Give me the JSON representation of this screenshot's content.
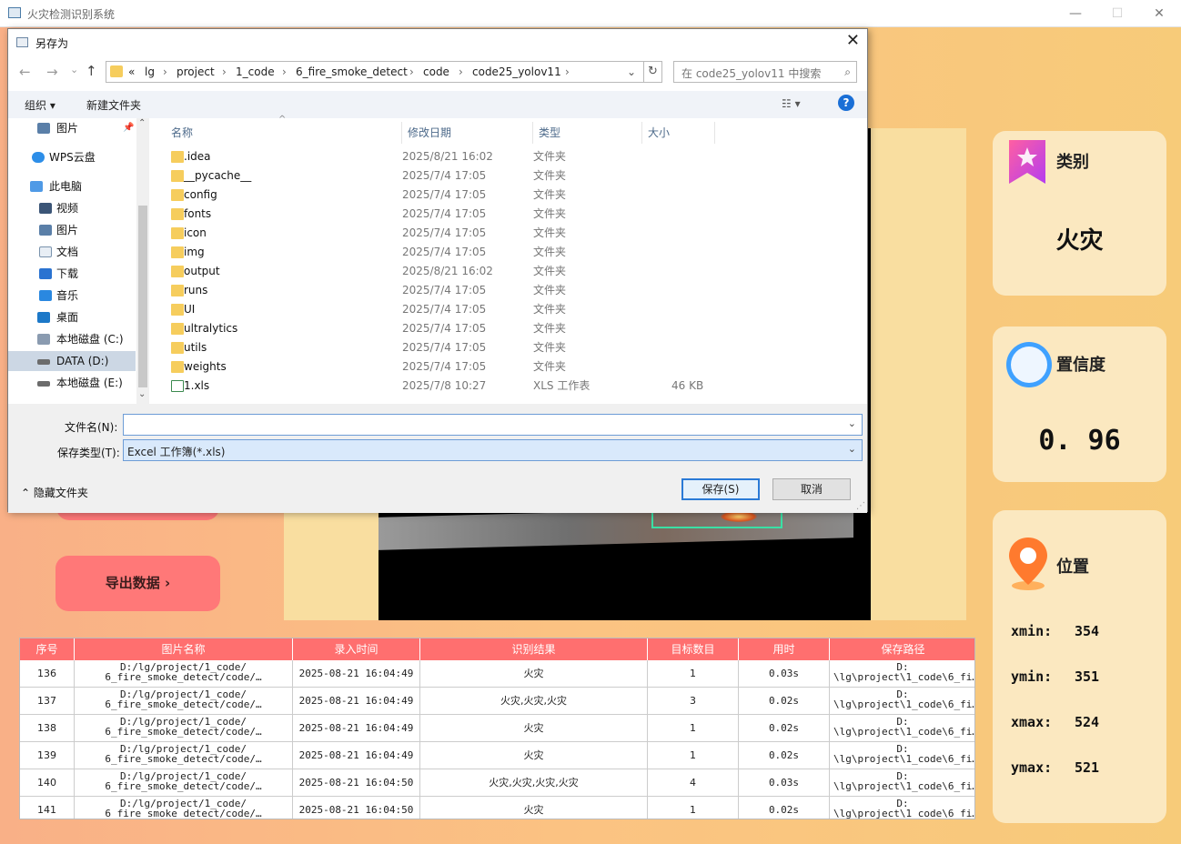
{
  "app": {
    "title": "火灾检测识别系统",
    "minimize": "—",
    "maximize": "☐",
    "close": "✕"
  },
  "buttons": {
    "export_label": "导出数据  ›"
  },
  "cards": {
    "category": {
      "title": "类别",
      "value": "火灾"
    },
    "confidence": {
      "title": "置信度",
      "value": "0. 96"
    },
    "location": {
      "title": "位置",
      "xmin_label": "xmin:",
      "xmin": "354",
      "ymin_label": "ymin:",
      "ymin": "351",
      "xmax_label": "xmax:",
      "xmax": "524",
      "ymax_label": "ymax:",
      "ymax": "521"
    }
  },
  "table": {
    "headers": [
      "序号",
      "图片名称",
      "录入时间",
      "识别结果",
      "目标数目",
      "用时",
      "保存路径"
    ],
    "rows": [
      {
        "id": "136",
        "name1": "D:/lg/project/1_code/",
        "name2": "6_fire_smoke_detect/code/…",
        "time": "2025-08-21 16:04:49",
        "result": "火灾",
        "count": "1",
        "used": "0.03s",
        "path1": "D:",
        "path2": "\\lg\\project\\1_code\\6_fi…"
      },
      {
        "id": "137",
        "name1": "D:/lg/project/1_code/",
        "name2": "6_fire_smoke_detect/code/…",
        "time": "2025-08-21 16:04:49",
        "result": "火灾,火灾,火灾",
        "count": "3",
        "used": "0.02s",
        "path1": "D:",
        "path2": "\\lg\\project\\1_code\\6_fi…"
      },
      {
        "id": "138",
        "name1": "D:/lg/project/1_code/",
        "name2": "6_fire_smoke_detect/code/…",
        "time": "2025-08-21 16:04:49",
        "result": "火灾",
        "count": "1",
        "used": "0.02s",
        "path1": "D:",
        "path2": "\\lg\\project\\1_code\\6_fi…"
      },
      {
        "id": "139",
        "name1": "D:/lg/project/1_code/",
        "name2": "6_fire_smoke_detect/code/…",
        "time": "2025-08-21 16:04:49",
        "result": "火灾",
        "count": "1",
        "used": "0.02s",
        "path1": "D:",
        "path2": "\\lg\\project\\1_code\\6_fi…"
      },
      {
        "id": "140",
        "name1": "D:/lg/project/1_code/",
        "name2": "6_fire_smoke_detect/code/…",
        "time": "2025-08-21 16:04:50",
        "result": "火灾,火灾,火灾,火灾",
        "count": "4",
        "used": "0.03s",
        "path1": "D:",
        "path2": "\\lg\\project\\1_code\\6_fi…"
      },
      {
        "id": "141",
        "name1": "D:/lg/project/1_code/",
        "name2": "6_fire_smoke_detect/code/…",
        "time": "2025-08-21 16:04:50",
        "result": "火灾",
        "count": "1",
        "used": "0.02s",
        "path1": "D:",
        "path2": "\\lg\\project\\1_code\\6_fi…"
      }
    ]
  },
  "dialog": {
    "title": "另存为",
    "close": "✕",
    "back": "←",
    "forward": "→",
    "recent": "⌄",
    "up": "↑",
    "breadcrumb": [
      "«",
      "lg",
      "project",
      "1_code",
      "6_fire_smoke_detect",
      "code",
      "code25_yolov11"
    ],
    "sep": "›",
    "address_chevron": "⌄",
    "refresh": "↻",
    "search_placeholder": "在 code25_yolov11 中搜索",
    "search_icon": "⌕",
    "organize": "组织 ▾",
    "new_folder": "新建文件夹",
    "view_icon": "☷ ▾",
    "help": "?",
    "nav_items": [
      {
        "label": "图片",
        "pin": "📌"
      },
      {
        "label": "WPS云盘"
      },
      {
        "label": "此电脑"
      },
      {
        "label": "视频"
      },
      {
        "label": "图片"
      },
      {
        "label": "文档"
      },
      {
        "label": "下载"
      },
      {
        "label": "音乐"
      },
      {
        "label": "桌面"
      },
      {
        "label": "本地磁盘 (C:)"
      },
      {
        "label": "DATA (D:)"
      },
      {
        "label": "本地磁盘 (E:)"
      }
    ],
    "scroll_up": "⌃",
    "scroll_down": "⌄",
    "columns": {
      "name": "名称",
      "date": "修改日期",
      "type": "类型",
      "size": "大小",
      "sort_indicator": "^"
    },
    "files": [
      {
        "name": ".idea",
        "date": "2025/8/21 16:02",
        "type": "文件夹",
        "size": ""
      },
      {
        "name": "__pycache__",
        "date": "2025/7/4 17:05",
        "type": "文件夹",
        "size": ""
      },
      {
        "name": "config",
        "date": "2025/7/4 17:05",
        "type": "文件夹",
        "size": ""
      },
      {
        "name": "fonts",
        "date": "2025/7/4 17:05",
        "type": "文件夹",
        "size": ""
      },
      {
        "name": "icon",
        "date": "2025/7/4 17:05",
        "type": "文件夹",
        "size": ""
      },
      {
        "name": "img",
        "date": "2025/7/4 17:05",
        "type": "文件夹",
        "size": ""
      },
      {
        "name": "output",
        "date": "2025/8/21 16:02",
        "type": "文件夹",
        "size": ""
      },
      {
        "name": "runs",
        "date": "2025/7/4 17:05",
        "type": "文件夹",
        "size": ""
      },
      {
        "name": "UI",
        "date": "2025/7/4 17:05",
        "type": "文件夹",
        "size": ""
      },
      {
        "name": "ultralytics",
        "date": "2025/7/4 17:05",
        "type": "文件夹",
        "size": ""
      },
      {
        "name": "utils",
        "date": "2025/7/4 17:05",
        "type": "文件夹",
        "size": ""
      },
      {
        "name": "weights",
        "date": "2025/7/4 17:05",
        "type": "文件夹",
        "size": ""
      },
      {
        "name": "1.xls",
        "date": "2025/7/8 10:27",
        "type": "XLS 工作表",
        "size": "46 KB"
      }
    ],
    "filename_label": "文件名(N):",
    "filename_value": "",
    "filetype_label": "保存类型(T):",
    "filetype_value": "Excel 工作簿(*.xls)",
    "combo_chevron": "⌄",
    "save": "保存(S)",
    "cancel": "取消",
    "hide_folders": "⌃  隐藏文件夹",
    "grip": "⋰"
  },
  "colors": {
    "accent_red": "#ff7878",
    "table_header": "#ff6f6f",
    "card_bg": "#fbe8c0",
    "detect_box": "#3ae0a5"
  }
}
